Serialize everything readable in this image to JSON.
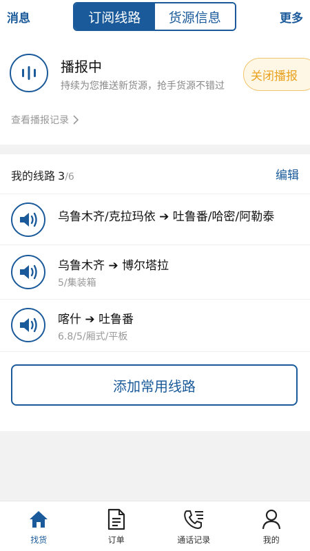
{
  "header": {
    "left_label": "消息",
    "right_label": "更多",
    "tabs": [
      {
        "label": "订阅线路",
        "active": true
      },
      {
        "label": "货源信息",
        "active": false
      }
    ]
  },
  "broadcast": {
    "status_title": "播报中",
    "subtitle": "持续为您推送新货源，抢手货源不错过",
    "close_button": "关闭播报",
    "record_link": "查看播报记录",
    "icon": "broadcast-icon"
  },
  "routes": {
    "title": "我的线路",
    "count": "3",
    "total": "/6",
    "edit_label": "编辑",
    "items": [
      {
        "from": "乌鲁木齐/克拉玛依",
        "arrow": "➔",
        "to": "吐鲁番/哈密/阿勒泰",
        "detail": ""
      },
      {
        "from": "乌鲁木齐",
        "arrow": "➔",
        "to": "博尔塔拉",
        "detail": "5/集装箱"
      },
      {
        "from": "喀什",
        "arrow": "➔",
        "to": "吐鲁番",
        "detail": "6.8/5/厢式/平板"
      }
    ],
    "add_button": "添加常用线路"
  },
  "tabbar": {
    "items": [
      {
        "label": "找货",
        "icon": "home-icon",
        "active": true
      },
      {
        "label": "订单",
        "icon": "order-icon",
        "active": false
      },
      {
        "label": "通话记录",
        "icon": "call-log-icon",
        "active": false
      },
      {
        "label": "我的",
        "icon": "profile-icon",
        "active": false
      }
    ]
  },
  "colors": {
    "accent": "#1a5a9a",
    "warning": "#e8a21f",
    "background": "#f2f2f2"
  }
}
